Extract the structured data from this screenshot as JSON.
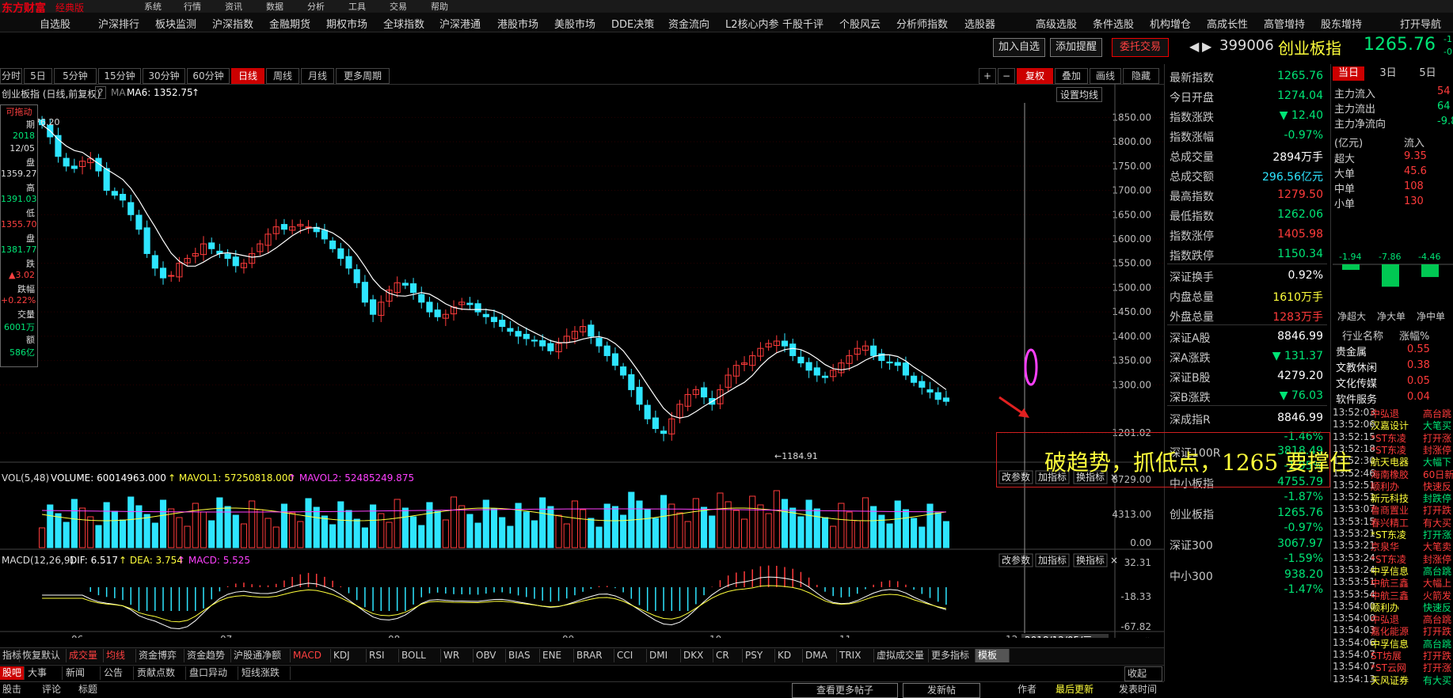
{
  "topbar": {
    "brand": "东方财富",
    "edition": "经典版",
    "items": [
      "系统",
      "行情",
      "资讯",
      "数据",
      "分析",
      "工具",
      "交易",
      "帮助"
    ]
  },
  "menu": {
    "items": [
      "自选股",
      "沪深排行",
      "板块监测",
      "沪深指数",
      "金融期货",
      "期权市场",
      "全球指数",
      "沪深港通",
      "港股市场",
      "美股市场",
      "DDE决策",
      "资金流向",
      "L2核心内参",
      "千股千评",
      "个股风云",
      "分析师指数",
      "选股器",
      "高级选股",
      "条件选股",
      "机构增仓",
      "高成长性",
      "高管增持",
      "股东增持",
      "打开导航"
    ]
  },
  "toolbar": {
    "add_watch": "加入自选",
    "add_alert": "添加提醒",
    "trade": "委托交易",
    "code": "399006",
    "name": "创业板指",
    "price": "1265.76",
    "change_small": "-1",
    "change_small2": "-0"
  },
  "periods": {
    "items": [
      "分时",
      "5日",
      "5分钟",
      "15分钟",
      "30分钟",
      "60分钟",
      "日线",
      "周线",
      "月线",
      "更多周期"
    ],
    "active": "日线"
  },
  "chart_tools": {
    "plus": "+",
    "minus": "−",
    "adjust": "复权",
    "overlay": "叠加",
    "draw": "画线",
    "hide": "隐藏"
  },
  "chart_header": {
    "title": "创业板指 (日线,前复权)",
    "help": "?",
    "ma_name": "MA",
    "ma6": "MA6: 1352.75",
    "set_ma": "设置均线"
  },
  "info_panel": {
    "title": "可拖动",
    "rows": [
      "期",
      "2018",
      "12/05",
      "盘",
      "1359.27",
      "高",
      "1391.03",
      "低",
      "1355.70",
      "盘",
      "1381.77",
      "跌",
      "▲3.02",
      "跌幅",
      "+0.22%",
      "交量",
      "6001万",
      "额",
      "586亿"
    ]
  },
  "price_axis": {
    "labels": [
      "1850.00",
      "1800.00",
      "1750.00",
      "1700.00",
      "1650.00",
      "1600.00",
      "1550.00",
      "1500.00",
      "1450.00",
      "1400.00",
      "1350.00",
      "1300.00",
      "1201.02"
    ],
    "high_mark": "76.20",
    "low_mark": "1184.91"
  },
  "annotation": {
    "text": "破趋势，抓低点，1265 要撑住"
  },
  "volume_panel": {
    "label": "VOL(5,48)",
    "volume": "VOLUME: 60014963.000",
    "mavol1": "MAVOL1: 57250818.000",
    "mavol2": "MAVOL2: 52485249.875",
    "axis": [
      "8729.00",
      "4313.00",
      "0.00"
    ],
    "btn1": "改参数",
    "btn2": "加指标",
    "btn3": "换指标",
    "close": "×"
  },
  "macd_panel": {
    "label": "MACD(12,26,9)",
    "dif": "DIF: 6.517",
    "dea": "DEA: 3.754",
    "macd": "MACD: 5.525",
    "axis": [
      "32.31",
      "-18.33",
      "-67.82"
    ],
    "btn1": "改参数",
    "btn2": "加指标",
    "btn3": "换指标",
    "close": "×"
  },
  "x_axis": {
    "labels": [
      "06",
      "07",
      "08",
      "09",
      "10",
      "11",
      "12"
    ],
    "cursor_date": "2018/12/05/三"
  },
  "chart_data": [
    {
      "type": "candlestick",
      "title": "创业板指 (日线,前复权)",
      "x": [
        "06",
        "07",
        "08",
        "09",
        "10",
        "11",
        "12"
      ],
      "ylim": [
        1184.91,
        1876.2
      ],
      "series_ma6_last": 1352.75,
      "close_approx": [
        1835,
        1810,
        1770,
        1750,
        1745,
        1760,
        1765,
        1740,
        1700,
        1690,
        1680,
        1650,
        1620,
        1570,
        1540,
        1520,
        1525,
        1550,
        1560,
        1570,
        1590,
        1580,
        1570,
        1560,
        1545,
        1550,
        1570,
        1590,
        1610,
        1625,
        1620,
        1625,
        1630,
        1625,
        1615,
        1600,
        1580,
        1560,
        1540,
        1510,
        1470,
        1445,
        1470,
        1495,
        1510,
        1505,
        1490,
        1470,
        1450,
        1440,
        1445,
        1460,
        1470,
        1465,
        1450,
        1440,
        1430,
        1420,
        1410,
        1400,
        1395,
        1390,
        1380,
        1370,
        1385,
        1400,
        1410,
        1420,
        1400,
        1380,
        1360,
        1340,
        1320,
        1290,
        1260,
        1230,
        1210,
        1200,
        1230,
        1260,
        1280,
        1290,
        1275,
        1260,
        1290,
        1320,
        1340,
        1345,
        1360,
        1375,
        1385,
        1390,
        1380,
        1360,
        1345,
        1330,
        1320,
        1315,
        1330,
        1345,
        1360,
        1375,
        1380,
        1360,
        1350,
        1345,
        1340,
        1320,
        1305,
        1295,
        1285,
        1270,
        1266
      ]
    },
    {
      "type": "bar",
      "title": "VOL(5,48)",
      "ylim": [
        0,
        8729
      ],
      "mavol1": 57250818.0,
      "mavol2": 52485249.875,
      "last_volume": 60014963.0
    },
    {
      "type": "bar",
      "title": "MACD(12,26,9)",
      "ylim": [
        -67.82,
        32.31
      ],
      "dif": 6.517,
      "dea": 3.754,
      "macd": 5.525
    }
  ],
  "quote": {
    "rows": [
      {
        "label": "最新指数",
        "value": "1265.76",
        "cls": "dn"
      },
      {
        "label": "今日开盘",
        "value": "1274.04",
        "cls": "dn"
      },
      {
        "label": "指数涨跌",
        "value": "▼ 12.40",
        "cls": "dn"
      },
      {
        "label": "指数涨幅",
        "value": "-0.97%",
        "cls": "dn"
      },
      {
        "label": "总成交量",
        "value": "2894万手",
        "cls": "wh"
      },
      {
        "label": "总成交额",
        "value": "296.56亿元",
        "cls": "cy"
      },
      {
        "label": "最高指数",
        "value": "1279.50",
        "cls": "up"
      },
      {
        "label": "最低指数",
        "value": "1262.06",
        "cls": "dn"
      },
      {
        "label": "指数涨停",
        "value": "1405.98",
        "cls": "up"
      },
      {
        "label": "指数跌停",
        "value": "1150.34",
        "cls": "dn"
      },
      {
        "label": "深证换手",
        "value": "0.92%",
        "cls": "wh"
      },
      {
        "label": "内盘总量",
        "value": "1610万手",
        "cls": "yl"
      },
      {
        "label": "外盘总量",
        "value": "1283万手",
        "cls": "up"
      },
      {
        "label": "深证A股",
        "value": "8846.99",
        "cls": "wh"
      },
      {
        "label": "深A涨跌",
        "value": "▼ 131.37",
        "cls": "dn"
      },
      {
        "label": "深证B股",
        "value": "4279.20",
        "cls": "wh"
      },
      {
        "label": "深B涨跌",
        "value": "▼ 76.03",
        "cls": "dn"
      },
      {
        "label": "深成指R",
        "value": "8846.99",
        "cls": "wh"
      }
    ],
    "lower": [
      {
        "label": "",
        "value": "-1.46%"
      },
      {
        "label": "深证100R",
        "value": "3818.49"
      },
      {
        "label": "",
        "value": "-1.95%"
      },
      {
        "label": "中小板指",
        "value": "4755.79"
      },
      {
        "label": "",
        "value": "-1.87%"
      },
      {
        "label": "创业板指",
        "value": "1265.76"
      },
      {
        "label": "",
        "value": "-0.97%"
      },
      {
        "label": "深证300",
        "value": "3067.97"
      },
      {
        "label": "",
        "value": "-1.59%"
      },
      {
        "label": "中小300",
        "value": "938.20"
      },
      {
        "label": "",
        "value": "-1.47%"
      }
    ]
  },
  "flow": {
    "tabs": [
      "当日",
      "3日",
      "5日"
    ],
    "rows": [
      {
        "label": "主力流入",
        "value": "54"
      },
      {
        "label": "主力流出",
        "value": "64"
      },
      {
        "label": "主力净流向",
        "value": "-9.8"
      }
    ],
    "unit": "(亿元)",
    "col": "流入",
    "size_rows": [
      {
        "label": "超大",
        "value": "9.35"
      },
      {
        "label": "大单",
        "value": "45.6"
      },
      {
        "label": "中单",
        "value": "108"
      },
      {
        "label": "小单",
        "value": "130"
      }
    ],
    "bar_labels": [
      "-1.94",
      "-7.86",
      "-4.46"
    ],
    "bar_cats": [
      "净超大",
      "净大单",
      "净中单"
    ],
    "bars": [
      -1.94,
      -7.86,
      -4.46
    ],
    "industry_header": [
      "行业名称",
      "涨幅%"
    ],
    "industries": [
      {
        "name": "贵金属",
        "pct": "0.55"
      },
      {
        "name": "文教休闲",
        "pct": "0.38"
      },
      {
        "name": "文化传媒",
        "pct": "0.05"
      },
      {
        "name": "软件服务",
        "pct": "0.04"
      }
    ]
  },
  "tape": [
    {
      "t": "13:52:03",
      "n": "中弘退",
      "m": "高台跳"
    },
    {
      "t": "13:52:06",
      "n": "汉嘉设计",
      "m": "大笔买"
    },
    {
      "t": "13:52:15",
      "n": "*ST东凌",
      "m": "打开涨"
    },
    {
      "t": "13:52:18",
      "n": "*ST东凌",
      "m": "封涨停"
    },
    {
      "t": "13:52:30",
      "n": "航天电器",
      "m": "大幅下"
    },
    {
      "t": "13:52:46",
      "n": "海南橡胶",
      "m": "60日新"
    },
    {
      "t": "13:52:51",
      "n": "顺利办",
      "m": "快速反"
    },
    {
      "t": "13:52:51",
      "n": "新元科技",
      "m": "封跌停"
    },
    {
      "t": "13:53:07",
      "n": "鲁商置业",
      "m": "打开跌"
    },
    {
      "t": "13:53:15",
      "n": "春兴精工",
      "m": "有大买"
    },
    {
      "t": "13:53:21",
      "n": "*ST东凌",
      "m": "打开涨"
    },
    {
      "t": "13:53:21",
      "n": "京泉华",
      "m": "大笔卖"
    },
    {
      "t": "13:53:24",
      "n": "*ST东凌",
      "m": "封涨停"
    },
    {
      "t": "13:53:24",
      "n": "中孚信息",
      "m": "高台跳"
    },
    {
      "t": "13:53:51",
      "n": "中航三鑫",
      "m": "大幅上"
    },
    {
      "t": "13:53:54",
      "n": "中航三鑫",
      "m": "火箭发"
    },
    {
      "t": "13:54:00",
      "n": "顺利办",
      "m": "快速反"
    },
    {
      "t": "13:54:00",
      "n": "中弘退",
      "m": "高台跳"
    },
    {
      "t": "13:54:03",
      "n": "嘉化能源",
      "m": "打开跌"
    },
    {
      "t": "13:54:06",
      "n": "中孚信息",
      "m": "高台跳"
    },
    {
      "t": "13:54:07",
      "n": "ST坊展",
      "m": "打开跌"
    },
    {
      "t": "13:54:07",
      "n": "*ST云网",
      "m": "打开涨"
    },
    {
      "t": "13:54:13",
      "n": "天风证券",
      "m": "有大买"
    }
  ],
  "indicator_tabs": [
    "指标",
    "恢复默认",
    "成交量",
    "均线",
    "资金博弈",
    "资金趋势",
    "沪股通净额",
    "MACD",
    "KDJ",
    "RSI",
    "BOLL",
    "WR",
    "OBV",
    "BIAS",
    "ENE",
    "BRAR",
    "CCI",
    "DMI",
    "DKX",
    "CR",
    "PSY",
    "KD",
    "DMA",
    "TRIX",
    "虚拟成交量",
    "更多指标",
    "模板"
  ],
  "bottom": {
    "tabs": [
      "股吧",
      "大事",
      "新闻",
      "公告",
      "贡献点数",
      "盘口异动",
      "短线涨跌"
    ],
    "collapse": "收起",
    "row3": [
      "股击",
      "评论",
      "标题"
    ],
    "more_posts": "查看更多帖子",
    "post": "发新帖",
    "author": "作者",
    "last_update": "最后更新",
    "post_time": "发表时间"
  }
}
